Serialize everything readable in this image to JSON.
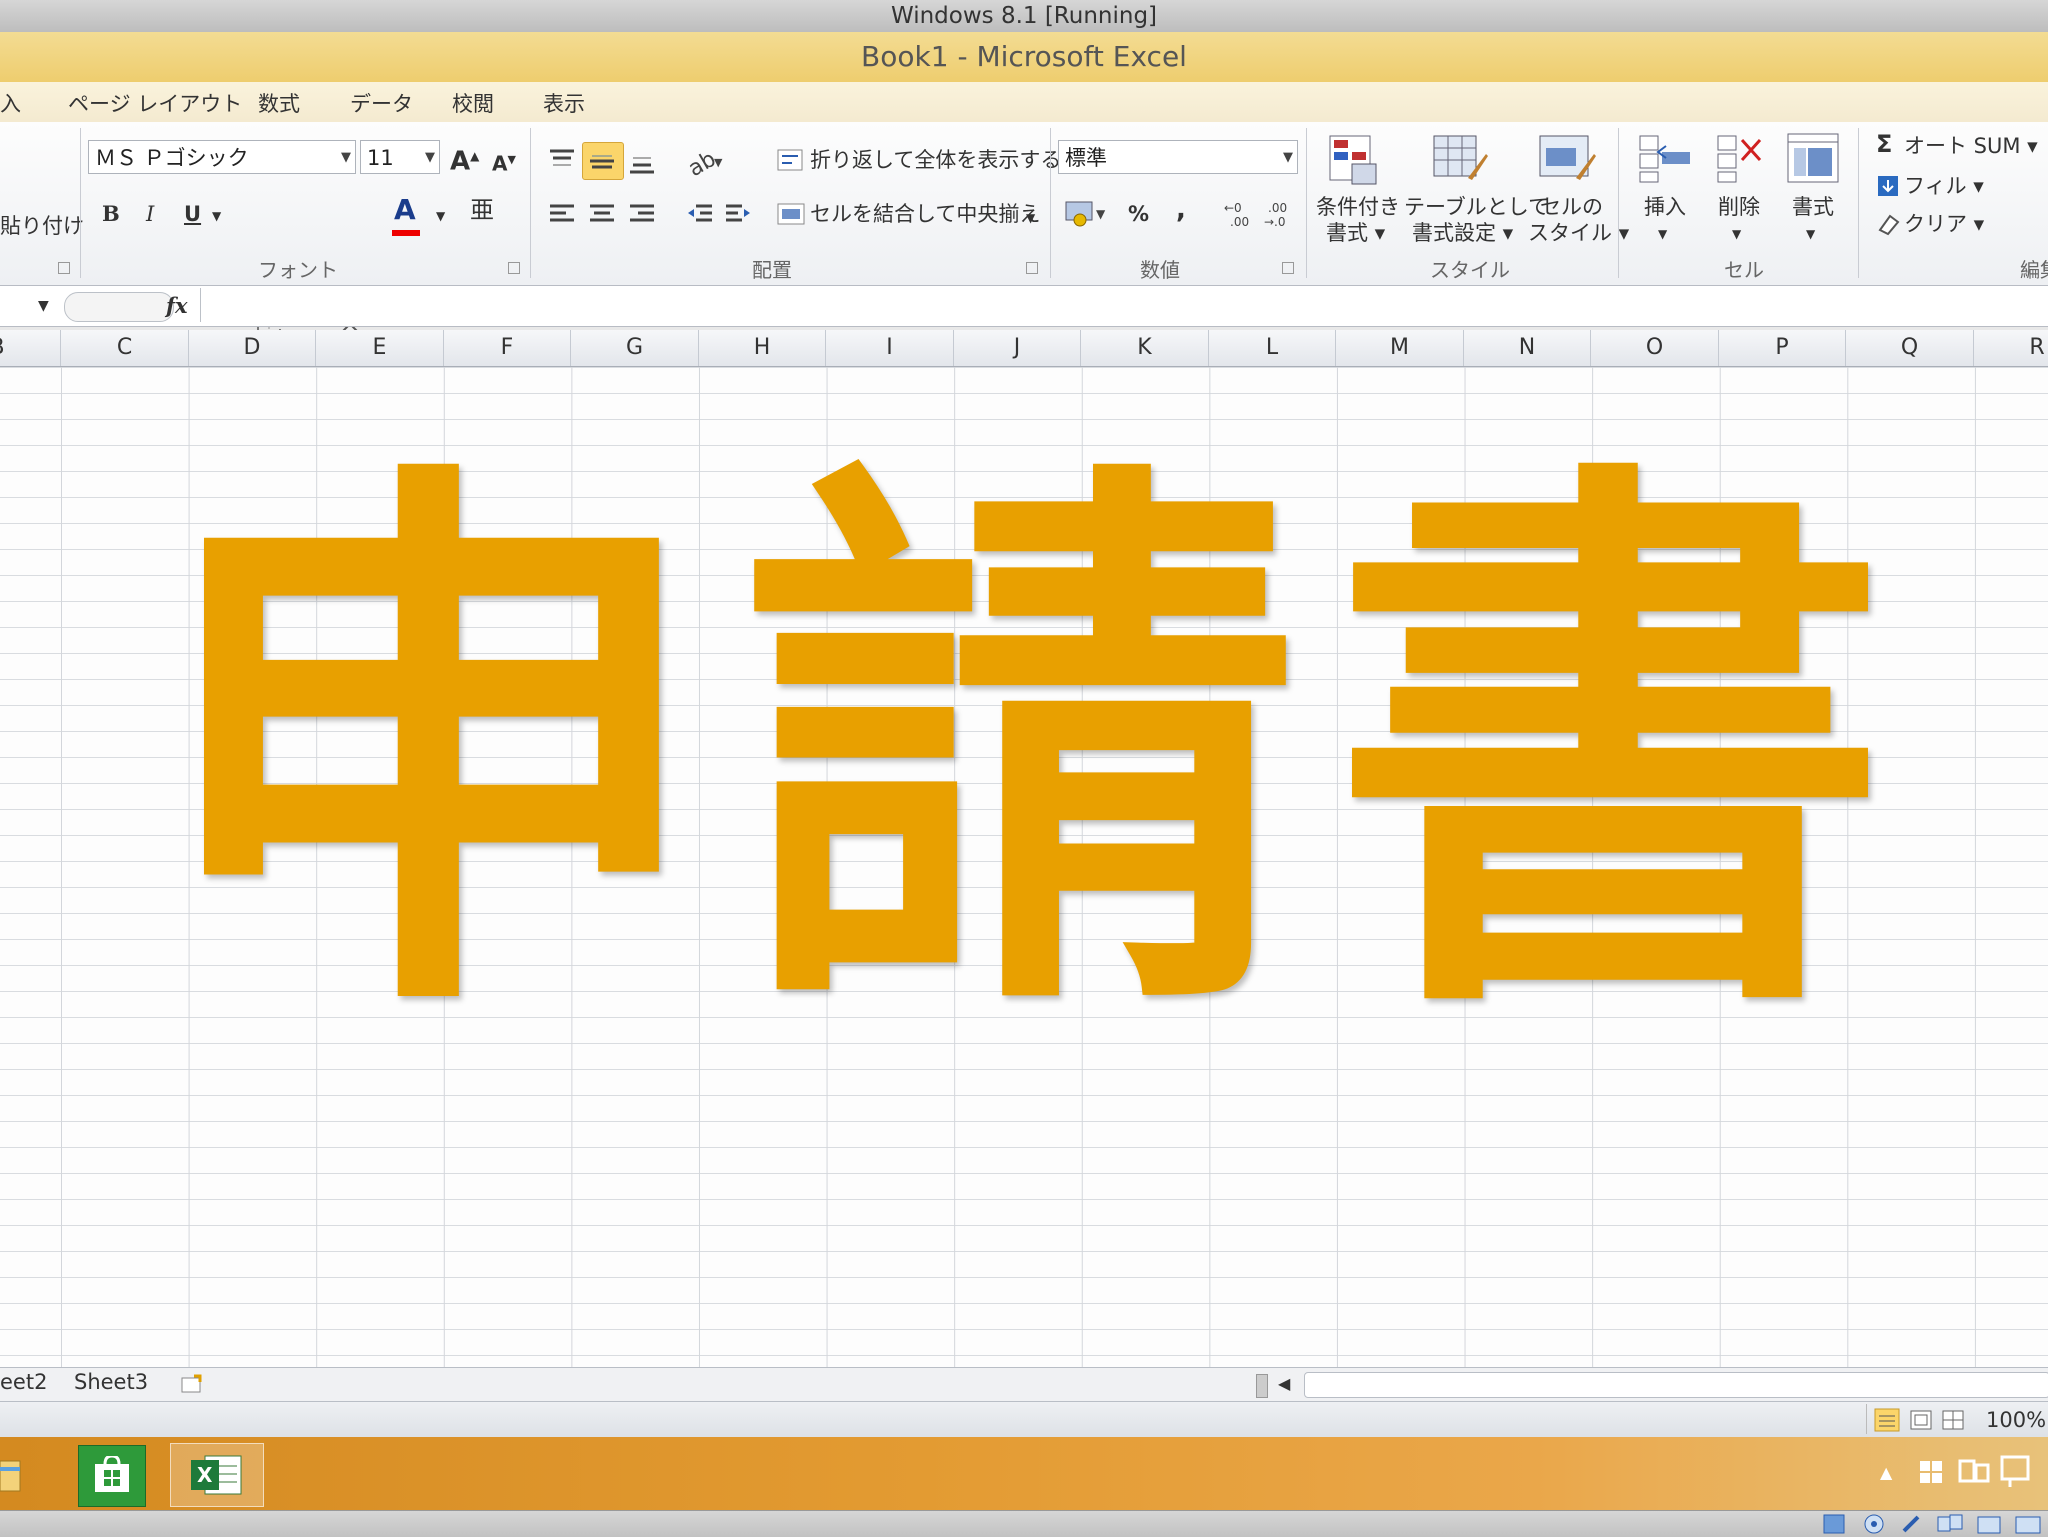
{
  "vm": {
    "title": "Windows 8.1 [Running]"
  },
  "window": {
    "title": "Book1  -  Microsoft Excel"
  },
  "menu": {
    "tabs": [
      "入",
      "ページ レイアウト",
      "数式",
      "データ",
      "校閲",
      "表示"
    ]
  },
  "ribbon": {
    "clipboard": {
      "paste_label": "貼り付け"
    },
    "font": {
      "group_label": "フォント",
      "font_name": "ＭＳ Ｐゴシック",
      "font_size": "11",
      "bold": "B",
      "italic": "I",
      "underline": "U",
      "grow": "A",
      "shrink": "A",
      "font_color": "A"
    },
    "alignment": {
      "group_label": "配置",
      "wrap_text": "折り返して全体を表示する",
      "merge_center": "セルを結合して中央揃え"
    },
    "number": {
      "group_label": "数値",
      "format": "標準",
      "percent": "%",
      "comma": ","
    },
    "styles": {
      "group_label": "スタイル",
      "conditional_1": "条件付き",
      "conditional_2": "書式",
      "table_1": "テーブルとして",
      "table_2": "書式設定",
      "cell_1": "セルの",
      "cell_2": "スタイル"
    },
    "cells": {
      "group_label": "セル",
      "insert": "挿入",
      "delete": "削除",
      "format": "書式"
    },
    "editing": {
      "group_label": "編集",
      "autosum": "オート SUM",
      "fill": "フィル",
      "clear": "クリア"
    }
  },
  "formula_bar": {
    "fx": "fx",
    "value": ""
  },
  "columns": [
    "B",
    "C",
    "D",
    "E",
    "F",
    "G",
    "H",
    "I",
    "J",
    "K",
    "L",
    "M",
    "N",
    "O",
    "P",
    "Q",
    "R"
  ],
  "content": {
    "big_text": "申請書",
    "color": "#e8a000"
  },
  "sheets": [
    "eet2",
    "Sheet3"
  ],
  "status": {
    "zoom": "100%"
  }
}
